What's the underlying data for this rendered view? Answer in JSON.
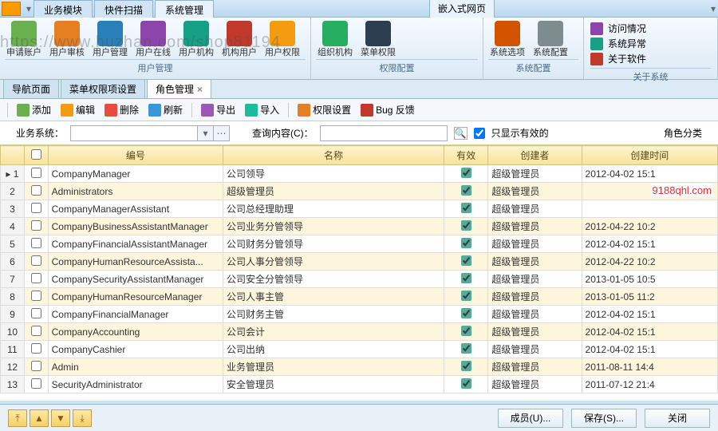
{
  "topbar_tabs": [
    "业务模块",
    "快件扫描",
    "系统管理"
  ],
  "topbar_active": 2,
  "topbar_right": "嵌入式网页",
  "watermark_url": "https://www.huzhan.com/shop81194",
  "ribbon": {
    "g1": {
      "title": "用户管理",
      "items": [
        "申请账户",
        "用户审核",
        "用户管理",
        "用户在线",
        "用户机构",
        "机构用户",
        "用户权限"
      ]
    },
    "g2": {
      "title": "权限配置",
      "items": [
        "组织机构",
        "菜单权限"
      ]
    },
    "g3": {
      "title": "系统配置",
      "items": [
        "系统选项",
        "系统配置"
      ]
    },
    "g4": {
      "title": "关于系统",
      "items": [
        "访问情况",
        "系统异常",
        "关于软件"
      ]
    }
  },
  "icon_colors": [
    "#6ab04c",
    "#e67e22",
    "#2980b9",
    "#8e44ad",
    "#16a085",
    "#c0392b",
    "#f39c12",
    "#27ae60",
    "#2c3e50",
    "#d35400",
    "#7f8c8d"
  ],
  "doc_tabs": [
    {
      "label": "导航页面",
      "active": false
    },
    {
      "label": "菜单权限项设置",
      "active": false
    },
    {
      "label": "角色管理",
      "active": true
    }
  ],
  "toolbar": [
    {
      "icon": "#6ab04c",
      "label": "添加"
    },
    {
      "icon": "#f39c12",
      "label": "编辑"
    },
    {
      "icon": "#e74c3c",
      "label": "删除"
    },
    {
      "icon": "#3498db",
      "label": "刷新"
    },
    {
      "sep": true
    },
    {
      "icon": "#9b59b6",
      "label": "导出"
    },
    {
      "icon": "#1abc9c",
      "label": "导入"
    },
    {
      "sep": true
    },
    {
      "icon": "#e67e22",
      "label": "权限设置"
    },
    {
      "icon": "#c0392b",
      "label": "Bug 反馈"
    }
  ],
  "filter": {
    "biz_label": "业务系统：",
    "query_label": "查询内容(C)：",
    "only_valid": "只显示有效的",
    "category": "角色分类"
  },
  "columns": [
    "",
    "",
    "编号",
    "名称",
    "有效",
    "创建者",
    "创建时间"
  ],
  "rows": [
    {
      "n": 1,
      "code": "CompanyManager",
      "name": "公司领导",
      "valid": true,
      "creator": "超级管理员",
      "time": "2012-04-02 15:1",
      "hl": false
    },
    {
      "n": 2,
      "code": "Administrators",
      "name": "超级管理员",
      "valid": true,
      "creator": "超级管理员",
      "time": "",
      "hl": true
    },
    {
      "n": 3,
      "code": "CompanyManagerAssistant",
      "name": "公司总经理助理",
      "valid": true,
      "creator": "超级管理员",
      "time": "",
      "hl": false
    },
    {
      "n": 4,
      "code": "CompanyBusinessAssistantManager",
      "name": "公司业务分管领导",
      "valid": true,
      "creator": "超级管理员",
      "time": "2012-04-22 10:2",
      "hl": true
    },
    {
      "n": 5,
      "code": "CompanyFinancialAssistantManager",
      "name": "公司财务分管领导",
      "valid": true,
      "creator": "超级管理员",
      "time": "2012-04-02 15:1",
      "hl": false
    },
    {
      "n": 6,
      "code": "CompanyHumanResourceAssista...",
      "name": "公司人事分管领导",
      "valid": true,
      "creator": "超级管理员",
      "time": "2012-04-22 10:2",
      "hl": true
    },
    {
      "n": 7,
      "code": "CompanySecurityAssistantManager",
      "name": "公司安全分管领导",
      "valid": true,
      "creator": "超级管理员",
      "time": "2013-01-05 10:5",
      "hl": false
    },
    {
      "n": 8,
      "code": "CompanyHumanResourceManager",
      "name": "公司人事主管",
      "valid": true,
      "creator": "超级管理员",
      "time": "2013-01-05 11:2",
      "hl": true
    },
    {
      "n": 9,
      "code": "CompanyFinancialManager",
      "name": "公司财务主管",
      "valid": true,
      "creator": "超级管理员",
      "time": "2012-04-02 15:1",
      "hl": false
    },
    {
      "n": 10,
      "code": "CompanyAccounting",
      "name": "公司会计",
      "valid": true,
      "creator": "超级管理员",
      "time": "2012-04-02 15:1",
      "hl": true
    },
    {
      "n": 11,
      "code": "CompanyCashier",
      "name": "公司出纳",
      "valid": true,
      "creator": "超级管理员",
      "time": "2012-04-02 15:1",
      "hl": false
    },
    {
      "n": 12,
      "code": "Admin",
      "name": "业务管理员",
      "valid": true,
      "creator": "超级管理员",
      "time": "2011-08-11 14:4",
      "hl": true
    },
    {
      "n": 13,
      "code": "SecurityAdministrator",
      "name": "安全管理员",
      "valid": true,
      "creator": "超级管理员",
      "time": "2011-07-12 21:4",
      "hl": false
    }
  ],
  "watermark2": "9188qhl.com",
  "footer": {
    "members": "成员(U)...",
    "save": "保存(S)...",
    "close": "关闭"
  }
}
